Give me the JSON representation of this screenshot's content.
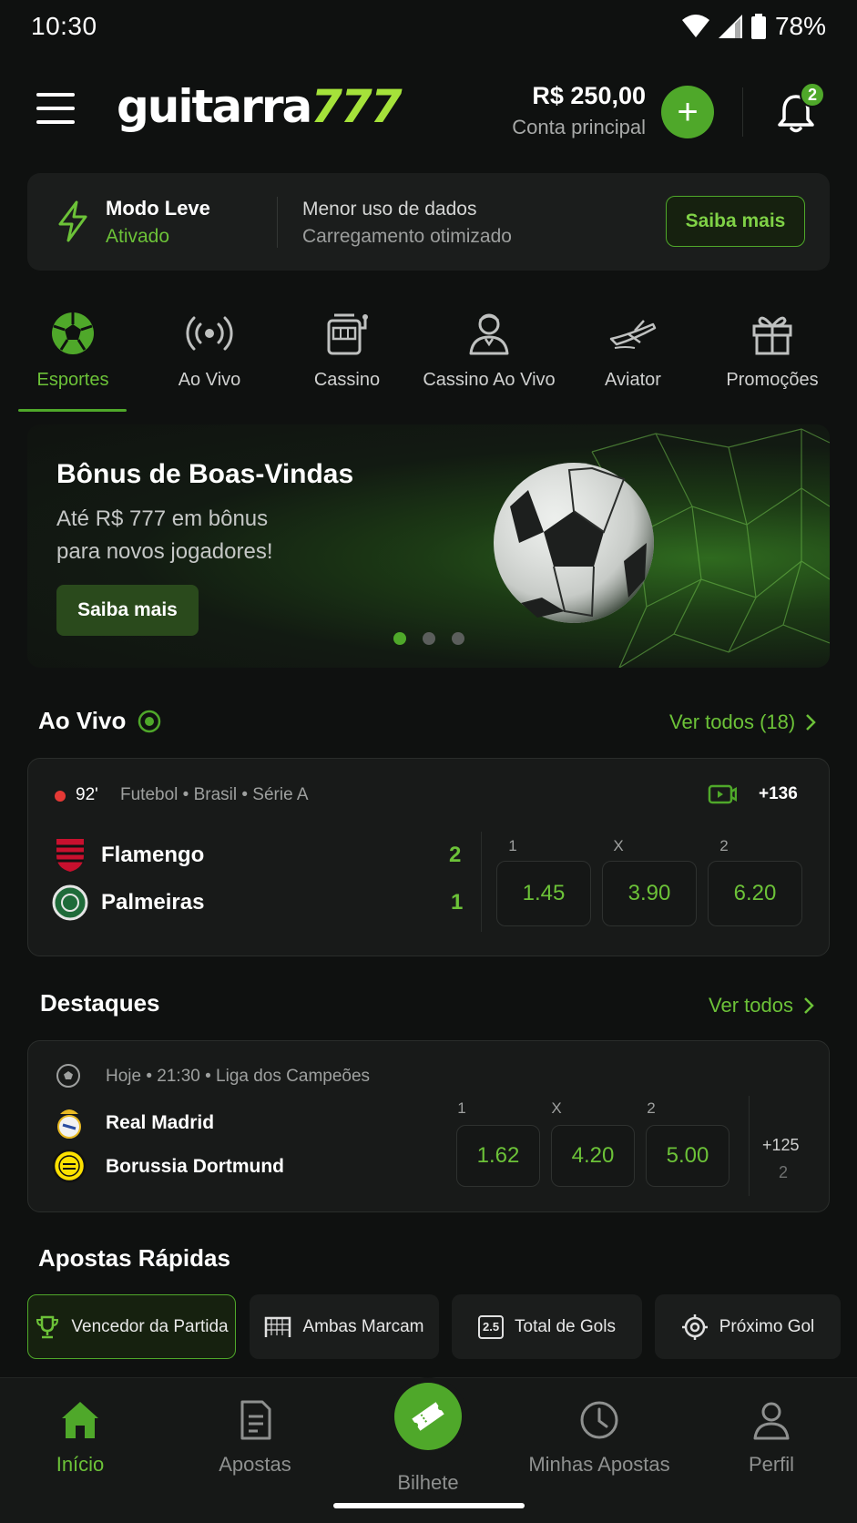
{
  "status_bar": {
    "time": "10:30",
    "battery": "78%"
  },
  "header": {
    "logo_text": "guitarra",
    "logo_num": "777",
    "balance": "R$ 250,00",
    "balance_label": "Conta principal",
    "add_label": "+",
    "notifications_count": "2"
  },
  "lite_mode": {
    "title": "Modo Leve",
    "status": "Ativado",
    "desc1": "Menor uso de dados",
    "desc2": "Carregamento otimizado",
    "button": "Saiba mais"
  },
  "categories": [
    {
      "label": "Esportes",
      "icon": "soccer-ball-icon",
      "active": true
    },
    {
      "label": "Ao Vivo",
      "icon": "broadcast-icon"
    },
    {
      "label": "Cassino",
      "icon": "slot-machine-icon"
    },
    {
      "label": "Cassino Ao Vivo",
      "icon": "dealer-icon"
    },
    {
      "label": "Aviator",
      "icon": "airplane-icon"
    },
    {
      "label": "Promoções",
      "icon": "gift-icon"
    }
  ],
  "banner": {
    "title": "Bônus de Boas-Vindas",
    "line1": "Até R$ 777 em bônus",
    "line2": "para novos jogadores!",
    "button": "Saiba mais"
  },
  "live_section": {
    "title": "Ao Vivo",
    "link": "Ver todos (18)",
    "match": {
      "minute": "92'",
      "league": "Futebol • Brasil • Série A",
      "markets": "+136",
      "home": "Flamengo",
      "away": "Palmeiras",
      "home_score": "2",
      "away_score": "1",
      "odd_heads": [
        "1",
        "X",
        "2"
      ],
      "odds": [
        "1.45",
        "3.90",
        "6.20"
      ]
    }
  },
  "highlights": {
    "title": "Destaques",
    "link": "Ver todos",
    "match": {
      "info": "Hoje • 21:30 • Liga dos Campeões",
      "home": "Real Madrid",
      "away": "Borussia Dortmund",
      "odd_heads": [
        "1",
        "X",
        "2"
      ],
      "odds": [
        "1.62",
        "4.20",
        "5.00"
      ],
      "markets": "+125",
      "markets_sub": "2"
    }
  },
  "quick_bets": {
    "title": "Apostas Rápidas",
    "chips": [
      {
        "label": "Vencedor da Partida",
        "icon": "trophy-icon"
      },
      {
        "label": "Ambas Marcam",
        "icon": "goal-net-icon"
      },
      {
        "label": "Total de Gols",
        "icon": "total-2-5-icon",
        "badge": "2.5"
      },
      {
        "label": "Próximo Gol",
        "icon": "target-icon"
      }
    ]
  },
  "bottom_nav": [
    {
      "label": "Início",
      "icon": "home-icon"
    },
    {
      "label": "Apostas",
      "icon": "document-icon"
    },
    {
      "label": "Bilhete",
      "icon": "ticket-icon"
    },
    {
      "label": "Minhas Apostas",
      "icon": "clock-icon"
    },
    {
      "label": "Perfil",
      "icon": "user-icon"
    }
  ],
  "colors": {
    "accent": "#4fa82a",
    "accent_light": "#6cc238",
    "background": "#0f1110",
    "card": "#181a19"
  }
}
